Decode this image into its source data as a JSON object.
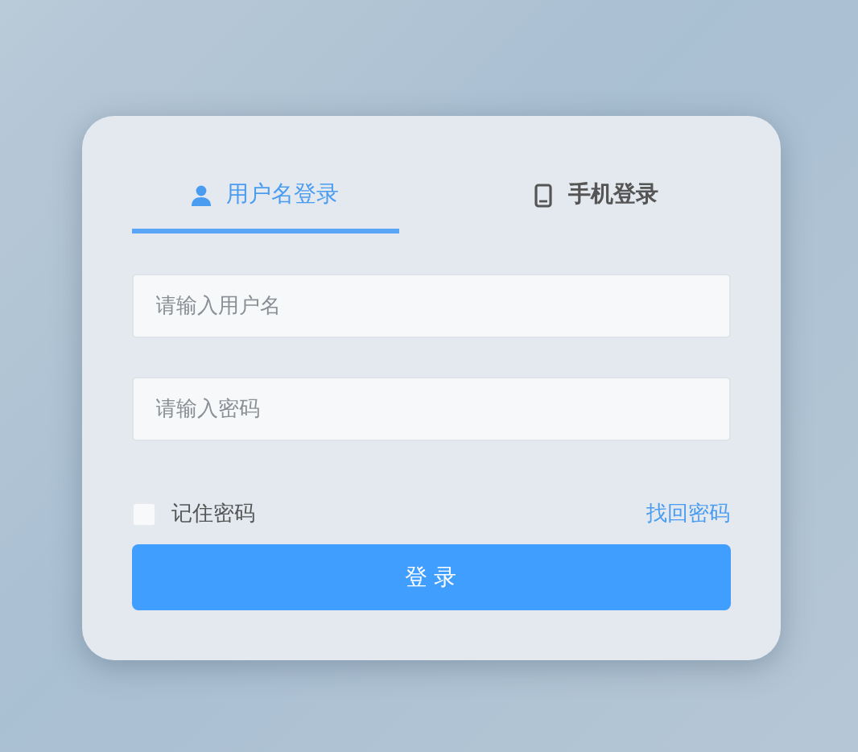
{
  "tabs": [
    {
      "label": "用户名登录",
      "selected": true
    },
    {
      "label": "手机登录",
      "selected": false
    }
  ],
  "fields": [
    {
      "placeholder": "请输入用户名"
    },
    {
      "placeholder": "请输入密码"
    }
  ],
  "remember": {
    "label": "记住密码",
    "checked": false
  },
  "forgot_link": "找回密码",
  "submit_button": "登 录"
}
